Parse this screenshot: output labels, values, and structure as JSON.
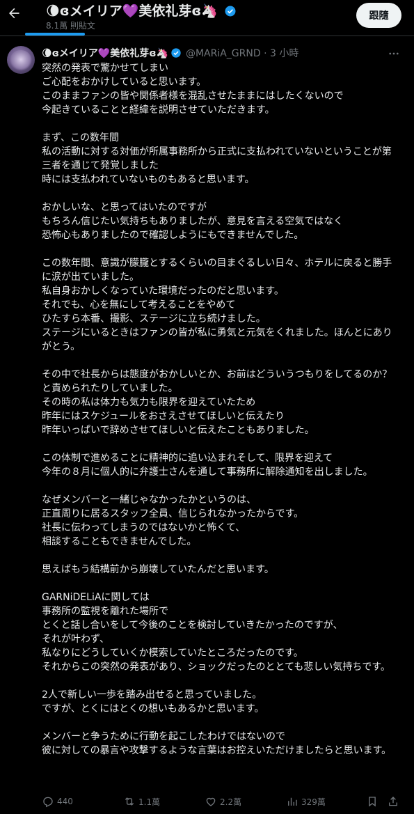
{
  "header": {
    "title": "🌘ɞメイリア💜美依礼芽ɞ🦄",
    "subtitle": "8.1萬 則貼文",
    "follow_label": "跟隨"
  },
  "tweet": {
    "display_name": "🌘ɞメイリア💜美依礼芽ɞ🦄",
    "handle_time": "@MARiA_GRND · 3 小時",
    "paragraphs": [
      "突然の発表で驚かせてしまい\nご心配をおかけしていると思います。\nこのままファンの皆や関係者様を混乱させたままにはしたくないので\n今起きていることと経緯を説明させていただきます。",
      "まず、この数年間\n私の活動に対する対価が所属事務所から正式に支払われていないということが第三者を通じて発覚しました\n時には支払われていないものもあると思います。",
      "おかしいな、と思ってはいたのですが\nもちろん信じたい気持ちもありましたが、意見を言える空気ではなく\n恐怖心もありましたので確認しようにもできませんでした。",
      "この数年間、意識が朦朧とするくらいの目まぐるしい日々、ホテルに戻ると勝手に涙が出ていました。\n私自身おかしくなっていた環境だったのだと思います。\nそれでも、心を無にして考えることをやめて\nひたすら本番、撮影、ステージに立ち続けました。\nステージにいるときはファンの皆が私に勇気と元気をくれました。ほんとにありがとう。",
      "その中で社長からは態度がおかしいとか、お前はどういうつもりをしてるのか？と責められたりしていました。\nその時の私は体力も気力も限界を迎えていたため\n昨年にはスケジュールをおさえさせてほしいと伝えたり\n昨年いっぱいで辞めさせてほしいと伝えたこともありました。",
      "この体制で進めることに精神的に追い込まれそして、限界を迎えて\n今年の８月に個人的に弁護士さんを通して事務所に解除通知を出しました。",
      "なぜメンバーと一緒じゃなかったかというのは、\n正直周りに居るスタッフ全員、信じられなかったからです。\n社長に伝わってしまうのではないかと怖くて、\n相談することもできませんでした。",
      "思えばもう結構前から崩壊していたんだと思います。",
      "GARNiDELiAに関しては\n事務所の監視を離れた場所で\nとくと話し合いをして今後のことを検討していきたかったのですが、\nそれが叶わず、\n私なりにどうしていくか模索していたところだったのです。\nそれからこの突然の発表があり、ショックだったのととても悲しい気持ちです。",
      "2人で新しい一歩を踏み出せると思っていました。\nですが、とくにはとくの想いもあるかと思います。",
      "メンバーと争うために行動を起こしたわけではないので\n彼に対しての暴言や攻撃するような言葉はお控えいただけましたらと思います。"
    ]
  },
  "actions": {
    "replies": "440",
    "reposts": "1.1萬",
    "likes": "2.2萬",
    "views": "329萬"
  },
  "colors": {
    "background": "#000000",
    "text": "#e7e9ea",
    "muted": "#71767b",
    "accent": "#1d9bf0",
    "button_bg": "#eff3f4"
  },
  "icons": [
    "back-arrow-icon",
    "verified-badge-icon",
    "more-icon",
    "reply-icon",
    "repost-icon",
    "like-icon",
    "views-icon",
    "bookmark-icon",
    "share-icon"
  ]
}
